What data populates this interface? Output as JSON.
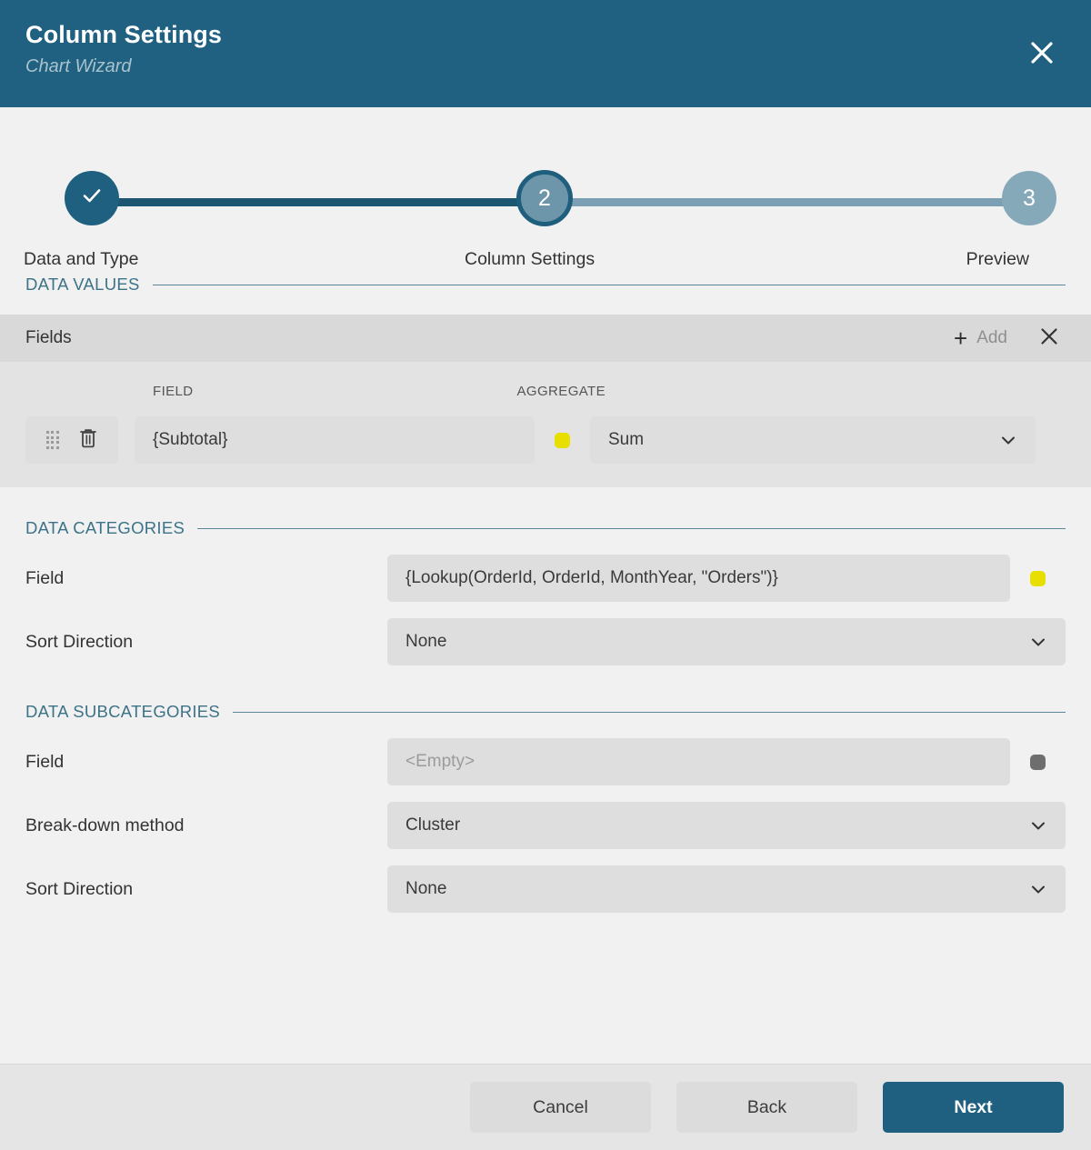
{
  "header": {
    "title": "Column Settings",
    "subtitle": "Chart Wizard",
    "close_icon": "close-icon"
  },
  "stepper": {
    "steps": [
      {
        "number": "✓",
        "label": "Data and Type",
        "state": "completed"
      },
      {
        "number": "2",
        "label": "Column Settings",
        "state": "current"
      },
      {
        "number": "3",
        "label": "Preview",
        "state": "upcoming"
      }
    ]
  },
  "data_values": {
    "section_title": "DATA VALUES",
    "toolbar": {
      "fields_label": "Fields",
      "add_label": "Add",
      "add_icon": "plus-icon",
      "close_icon": "close-icon"
    },
    "columns": {
      "field": "FIELD",
      "aggregate": "AGGREGATE"
    },
    "rows": [
      {
        "drag_icon": "drag-handle-icon",
        "delete_icon": "trash-icon",
        "field_value": "{Subtotal}",
        "status_dot": "#e8de00",
        "aggregate_value": "Sum",
        "aggregate_caret": "chevron-down-icon"
      }
    ]
  },
  "data_categories": {
    "section_title": "DATA CATEGORIES",
    "field_label": "Field",
    "field_value": "{Lookup(OrderId, OrderId, MonthYear, \"Orders\")}",
    "status_dot": "#e8de00",
    "sort_label": "Sort Direction",
    "sort_value": "None"
  },
  "data_subcategories": {
    "section_title": "DATA SUBCATEGORIES",
    "field_label": "Field",
    "field_placeholder": "<Empty>",
    "status_dot": "#6e6e6e",
    "breakdown_label": "Break-down method",
    "breakdown_value": "Cluster",
    "sort_label": "Sort Direction",
    "sort_value": "None"
  },
  "footer": {
    "cancel_label": "Cancel",
    "back_label": "Back",
    "next_label": "Next"
  },
  "colors": {
    "header_bg": "#206080",
    "accent": "#1f6080",
    "section_title": "#3d7388",
    "dot_active": "#e8de00",
    "dot_empty": "#6e6e6e"
  }
}
